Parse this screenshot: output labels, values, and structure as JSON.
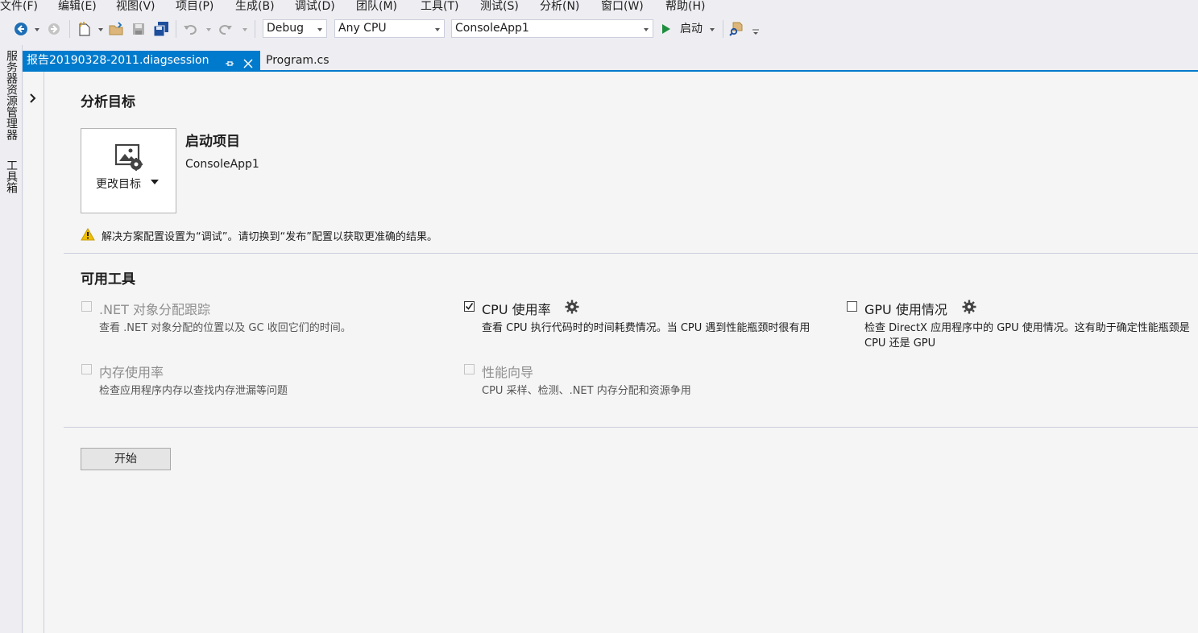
{
  "menu": [
    "文件(F)",
    "编辑(E)",
    "视图(V)",
    "项目(P)",
    "生成(B)",
    "调试(D)",
    "团队(M)",
    "工具(T)",
    "测试(S)",
    "分析(N)",
    "窗口(W)",
    "帮助(H)"
  ],
  "toolbar": {
    "config": "Debug",
    "platform": "Any CPU",
    "startup_project": "ConsoleApp1",
    "start_label": "启动"
  },
  "side_panels": [
    "服务器资源管理器",
    "工具箱"
  ],
  "tabs": [
    {
      "label": "报告20190328-2011.diagsession",
      "active": true
    },
    {
      "label": "Program.cs",
      "active": false
    }
  ],
  "analysis_target": {
    "title": "分析目标",
    "change_target_label": "更改目标",
    "target_heading": "启动项目",
    "target_name": "ConsoleApp1",
    "warning": "解决方案配置设置为“调试”。请切换到“发布”配置以获取更准确的结果。"
  },
  "tools": {
    "title": "可用工具",
    "items": [
      {
        "name": ".NET 对象分配跟踪",
        "desc": "查看 .NET 对象分配的位置以及 GC 收回它们的时间。",
        "checked": false,
        "enabled": false
      },
      {
        "name": "CPU 使用率",
        "desc": "查看 CPU 执行代码时的时间耗费情况。当 CPU 遇到性能瓶颈时很有用",
        "checked": true,
        "enabled": true
      },
      {
        "name": "GPU 使用情况",
        "desc": "检查 DirectX 应用程序中的 GPU 使用情况。这有助于确定性能瓶颈是 CPU 还是 GPU",
        "checked": false,
        "enabled": true
      },
      {
        "name": "内存使用率",
        "desc": "检查应用程序内存以查找内存泄漏等问题",
        "checked": false,
        "enabled": false
      },
      {
        "name": "性能向导",
        "desc": "CPU 采样、检测、.NET 内存分配和资源争用",
        "checked": false,
        "enabled": false
      }
    ]
  },
  "start_button": "开始",
  "colors": {
    "accent": "#007acc",
    "warning": "#f0c000",
    "play": "#1e8e3e"
  }
}
